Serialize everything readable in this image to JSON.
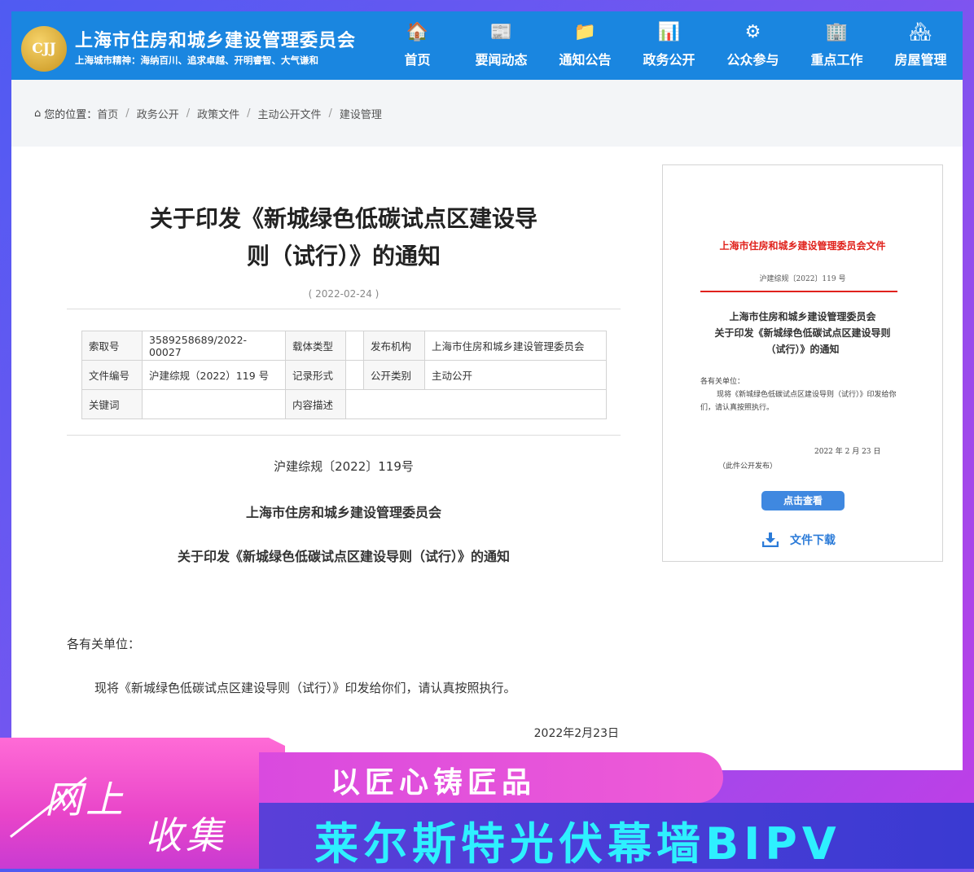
{
  "header": {
    "logo_text": "CJJ",
    "site_title": "上海市住房和城乡建设管理委员会",
    "site_subtitle": "上海城市精神：海纳百川、追求卓越、开明睿智、大气谦和",
    "nav": [
      {
        "label": "首页",
        "icon": "home-icon",
        "glyph": "🏠"
      },
      {
        "label": "要闻动态",
        "icon": "news-icon",
        "glyph": "📰"
      },
      {
        "label": "通知公告",
        "icon": "folder-icon",
        "glyph": "📁"
      },
      {
        "label": "政务公开",
        "icon": "chart-icon",
        "glyph": "📊"
      },
      {
        "label": "公众参与",
        "icon": "gear-icon",
        "glyph": "⚙"
      },
      {
        "label": "重点工作",
        "icon": "building-icon",
        "glyph": "🏢"
      },
      {
        "label": "房屋管理",
        "icon": "house-icon",
        "glyph": "🏘"
      }
    ]
  },
  "breadcrumb": {
    "prefix": "您的位置：",
    "items": [
      "首页",
      "政务公开",
      "政策文件",
      "主动公开文件",
      "建设管理"
    ]
  },
  "article": {
    "title_line1": "关于印发《新城绿色低碳试点区建设导",
    "title_line2": "则（试行）》的通知",
    "date": "( 2022-02-24 )",
    "meta": [
      [
        "索取号",
        "3589258689/2022-00027",
        "载体类型",
        "",
        "发布机构",
        "上海市住房和城乡建设管理委员会"
      ],
      [
        "文件编号",
        "沪建综规（2022）119 号",
        "记录形式",
        "",
        "公开类别",
        "主动公开"
      ],
      [
        "关键词",
        "",
        "内容描述",
        ""
      ]
    ],
    "doc_number": "沪建综规〔2022〕119号",
    "issuer": "上海市住房和城乡建设管理委员会",
    "subject": "关于印发《新城绿色低碳试点区建设导则（试行）》的通知",
    "salutation": "各有关单位：",
    "body": "现将《新城绿色低碳试点区建设导则（试行）》印发给你们，请认真按照执行。",
    "sign_date": "2022年2月23日"
  },
  "preview": {
    "doc_header": "上海市住房和城乡建设管理委员会文件",
    "doc_no": "沪建综规〔2022〕119 号",
    "title_lines": [
      "上海市住房和城乡建设管理委员会",
      "关于印发《新城绿色低碳试点区建设导则",
      "（试行）》的通知"
    ],
    "salutation": "各有关单位：",
    "body": "现将《新城绿色低碳试点区建设导则（试行）》印发给你们，请认真按照执行。",
    "date": "2022 年 2 月 23 日",
    "note": "（此件公开发布）",
    "view_button": "点击查看",
    "download_label": "文件下载"
  },
  "promo": {
    "collect1": "网上",
    "collect2": "收集",
    "slogan1": "以匠心铸匠品",
    "slogan2": "莱尔斯特光伏幕墙BIPV"
  },
  "colors": {
    "header_blue": "#1a86e0",
    "accent_red": "#e0221c",
    "button_blue": "#3f88e0",
    "promo_pink": "#e844c9",
    "promo_cyan": "#2ef0ff"
  }
}
